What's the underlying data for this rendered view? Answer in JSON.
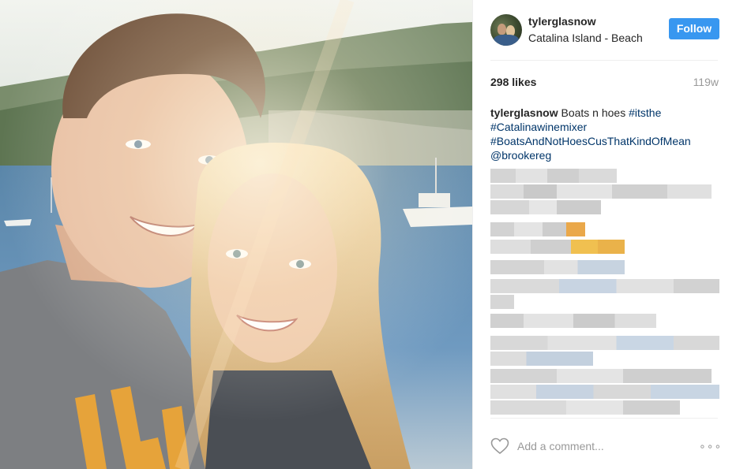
{
  "post": {
    "username": "tylerglasnow",
    "location": "Catalina Island - Beach",
    "follow_label": "Follow",
    "likes": "298 likes",
    "age": "119w",
    "caption": {
      "username": "tylerglasnow",
      "text": "Boats n hoes",
      "hashtags": [
        "#itsthe",
        "#Catalinawinemixer",
        "#BoatsAndNotHoesCusThatKindOfMean"
      ],
      "mention": "@brookereg"
    },
    "add_comment_placeholder": "Add a comment...",
    "more_options": "∘∘∘"
  },
  "colors": {
    "follow_button": "#3897f0",
    "hashtag_link": "#003569",
    "muted_text": "#999999",
    "primary_text": "#262626"
  },
  "icons": {
    "like": "heart-outline-icon",
    "more": "more-options-icon"
  }
}
